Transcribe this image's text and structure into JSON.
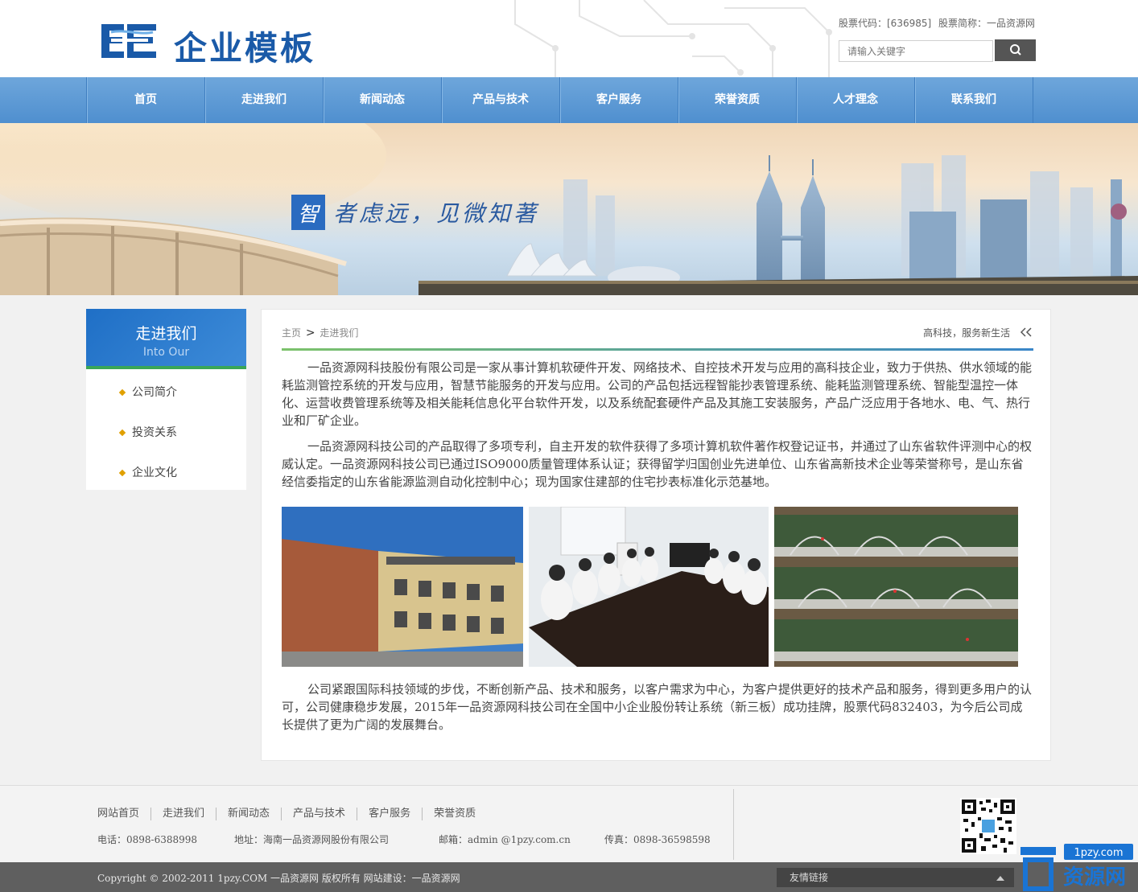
{
  "header": {
    "logo_text": "企业模板",
    "stock_code": "股票代码：[636985]",
    "stock_name": "股票简称：一品资源网",
    "search_placeholder": "请输入关键字"
  },
  "nav": {
    "items": [
      "首页",
      "走进我们",
      "新闻动态",
      "产品与技术",
      "客户服务",
      "荣誉资质",
      "人才理念",
      "联系我们"
    ]
  },
  "banner": {
    "slogan_first": "智",
    "slogan_rest": "者虑远，见微知著"
  },
  "sidebar": {
    "title": "走进我们",
    "subtitle": "Into Our",
    "items": [
      "公司简介",
      "投资关系",
      "企业文化"
    ]
  },
  "content": {
    "crumb_home": "主页",
    "crumb_sep": ">",
    "crumb_current": "走进我们",
    "tagline": "高科技，服务新生活",
    "tagline_icon": "double-chevron-left",
    "para1": "一品资源网科技股份有限公司是一家从事计算机软硬件开发、网络技术、自控技术开发与应用的高科技企业，致力于供热、供水领域的能耗监测管控系统的开发与应用，智慧节能服务的开发与应用。公司的产品包括远程智能抄表管理系统、能耗监测管理系统、智能型温控一体化、运营收费管理系统等及相关能耗信息化平台软件开发，以及系统配套硬件产品及其施工安装服务，产品广泛应用于各地水、电、气、热行业和厂矿企业。",
    "para2": "一品资源网科技公司的产品取得了多项专利，自主开发的软件获得了多项计算机软件著作权登记证书，并通过了山东省软件评测中心的权威认定。一品资源网科技公司已通过ISO9000质量管理体系认证；获得留学归国创业先进单位、山东省高新技术企业等荣誉称号，是山东省经信委指定的山东省能源监测自动化控制中心；现为国家住建部的住宅抄表标准化示范基地。",
    "para3": "公司紧跟国际科技领域的步伐，不断创新产品、技术和服务，以客户需求为中心，为客户提供更好的技术产品和服务，得到更多用户的认可，公司健康稳步发展，2015年一品资源网科技公司在全国中小企业股份转让系统（新三板）成功挂牌，股票代码832403，为今后公司成长提供了更为广阔的发展舞台。"
  },
  "footer": {
    "links": [
      "网站首页",
      "走进我们",
      "新闻动态",
      "产品与技术",
      "客户服务",
      "荣誉资质"
    ],
    "phone": "电话：0898-6388998",
    "address": "地址：海南一品资源网股份有限公司",
    "email": "邮箱：admin @1pzy.com.cn",
    "fax": "传真：0898-36598598",
    "copyright": "Copyright © 2002-2011 1pzy.COM 一品资源网 版权所有   网站建设：一品资源网",
    "friend_links": "友情链接",
    "watermark_domain": "1pzy.com",
    "watermark_name": "资源网"
  },
  "colors": {
    "brand_blue": "#1a5aa8",
    "nav_blue": "#5a97d4",
    "accent_green": "#3aa657",
    "bullet_gold": "#e0a000"
  }
}
